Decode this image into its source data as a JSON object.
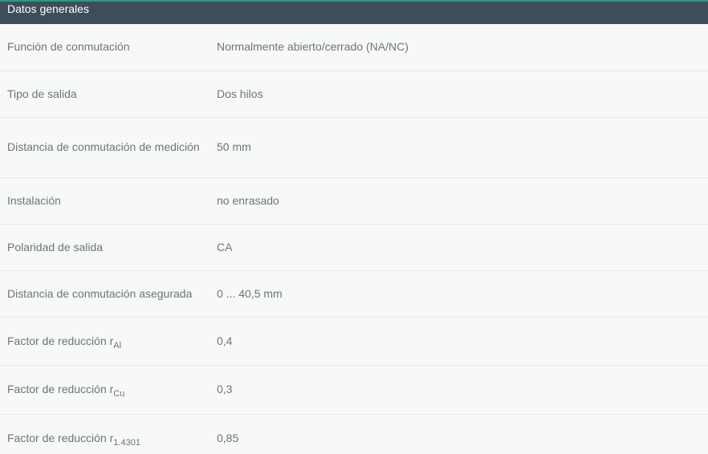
{
  "section": {
    "title": "Datos generales"
  },
  "rows": [
    {
      "label": "Función de conmutación",
      "value": "Normalmente abierto/cerrado (NA/NC)"
    },
    {
      "label": "Tipo de salida",
      "value": "Dos hilos"
    },
    {
      "label": "Distancia de conmutación de medición",
      "value": "50 mm"
    },
    {
      "label": "Instalación",
      "value": "no enrasado"
    },
    {
      "label": "Polaridad de salida",
      "value": "CA"
    },
    {
      "label": "Distancia de conmutación asegurada",
      "value": "0 ... 40,5 mm"
    },
    {
      "label": "Factor de reducción r",
      "sub": "Al",
      "value": "0,4"
    },
    {
      "label": "Factor de reducción r",
      "sub": "Cu",
      "value": "0,3"
    },
    {
      "label": "Factor de reducción r",
      "sub": "1.4301",
      "value": "0,85"
    }
  ]
}
